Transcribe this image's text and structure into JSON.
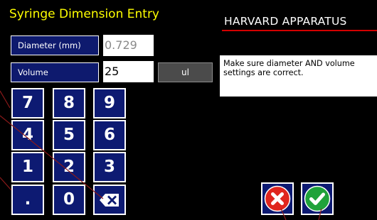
{
  "header": {
    "title": "Syringe Dimension Entry",
    "brand": "HARVARD APPARATUS"
  },
  "fields": {
    "diameter": {
      "label": "Diameter (mm)",
      "value": "0.729"
    },
    "volume": {
      "label": "Volume",
      "value": "25",
      "unit": "ul"
    }
  },
  "message": "Make sure diameter AND volume settings are correct.",
  "keypad": {
    "keys": [
      "7",
      "8",
      "9",
      "4",
      "5",
      "6",
      "1",
      "2",
      "3",
      ".",
      "0"
    ],
    "backspace_icon": "backspace-icon"
  },
  "actions": {
    "cancel_icon": "cancel-x-icon",
    "ok_icon": "confirm-check-icon"
  },
  "colors": {
    "title": "#ffff00",
    "button_blue": "#0d1a72",
    "brand_underline": "#d40000",
    "annotation_lines": "#8b1a1a",
    "cancel_red": "#e0261e",
    "confirm_green": "#1fa23a"
  }
}
